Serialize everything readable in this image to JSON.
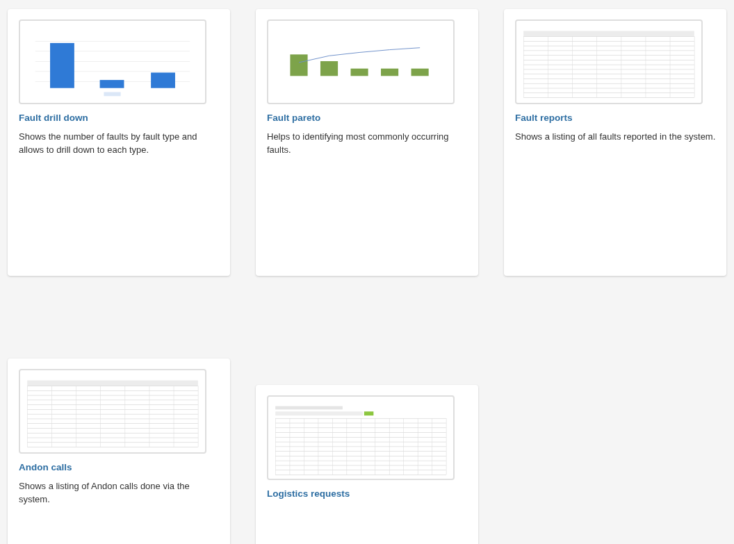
{
  "cards": [
    {
      "title": "Fault drill down",
      "description": "Shows the number of faults by fault type and allows to drill down to each type.",
      "thumbnail": {
        "kind": "bar"
      }
    },
    {
      "title": "Fault pareto",
      "description": "Helps to identifying most commonly occurring faults.",
      "thumbnail": {
        "kind": "pareto"
      }
    },
    {
      "title": "Fault reports",
      "description": "Shows a listing of all faults reported in the system.",
      "thumbnail": {
        "kind": "table"
      }
    },
    {
      "title": "Andon calls",
      "description": "Shows a listing of Andon calls done via the system.",
      "thumbnail": {
        "kind": "table"
      }
    },
    {
      "title": "Logistics requests",
      "thumbnail": {
        "kind": "toolbar-table"
      }
    }
  ]
}
